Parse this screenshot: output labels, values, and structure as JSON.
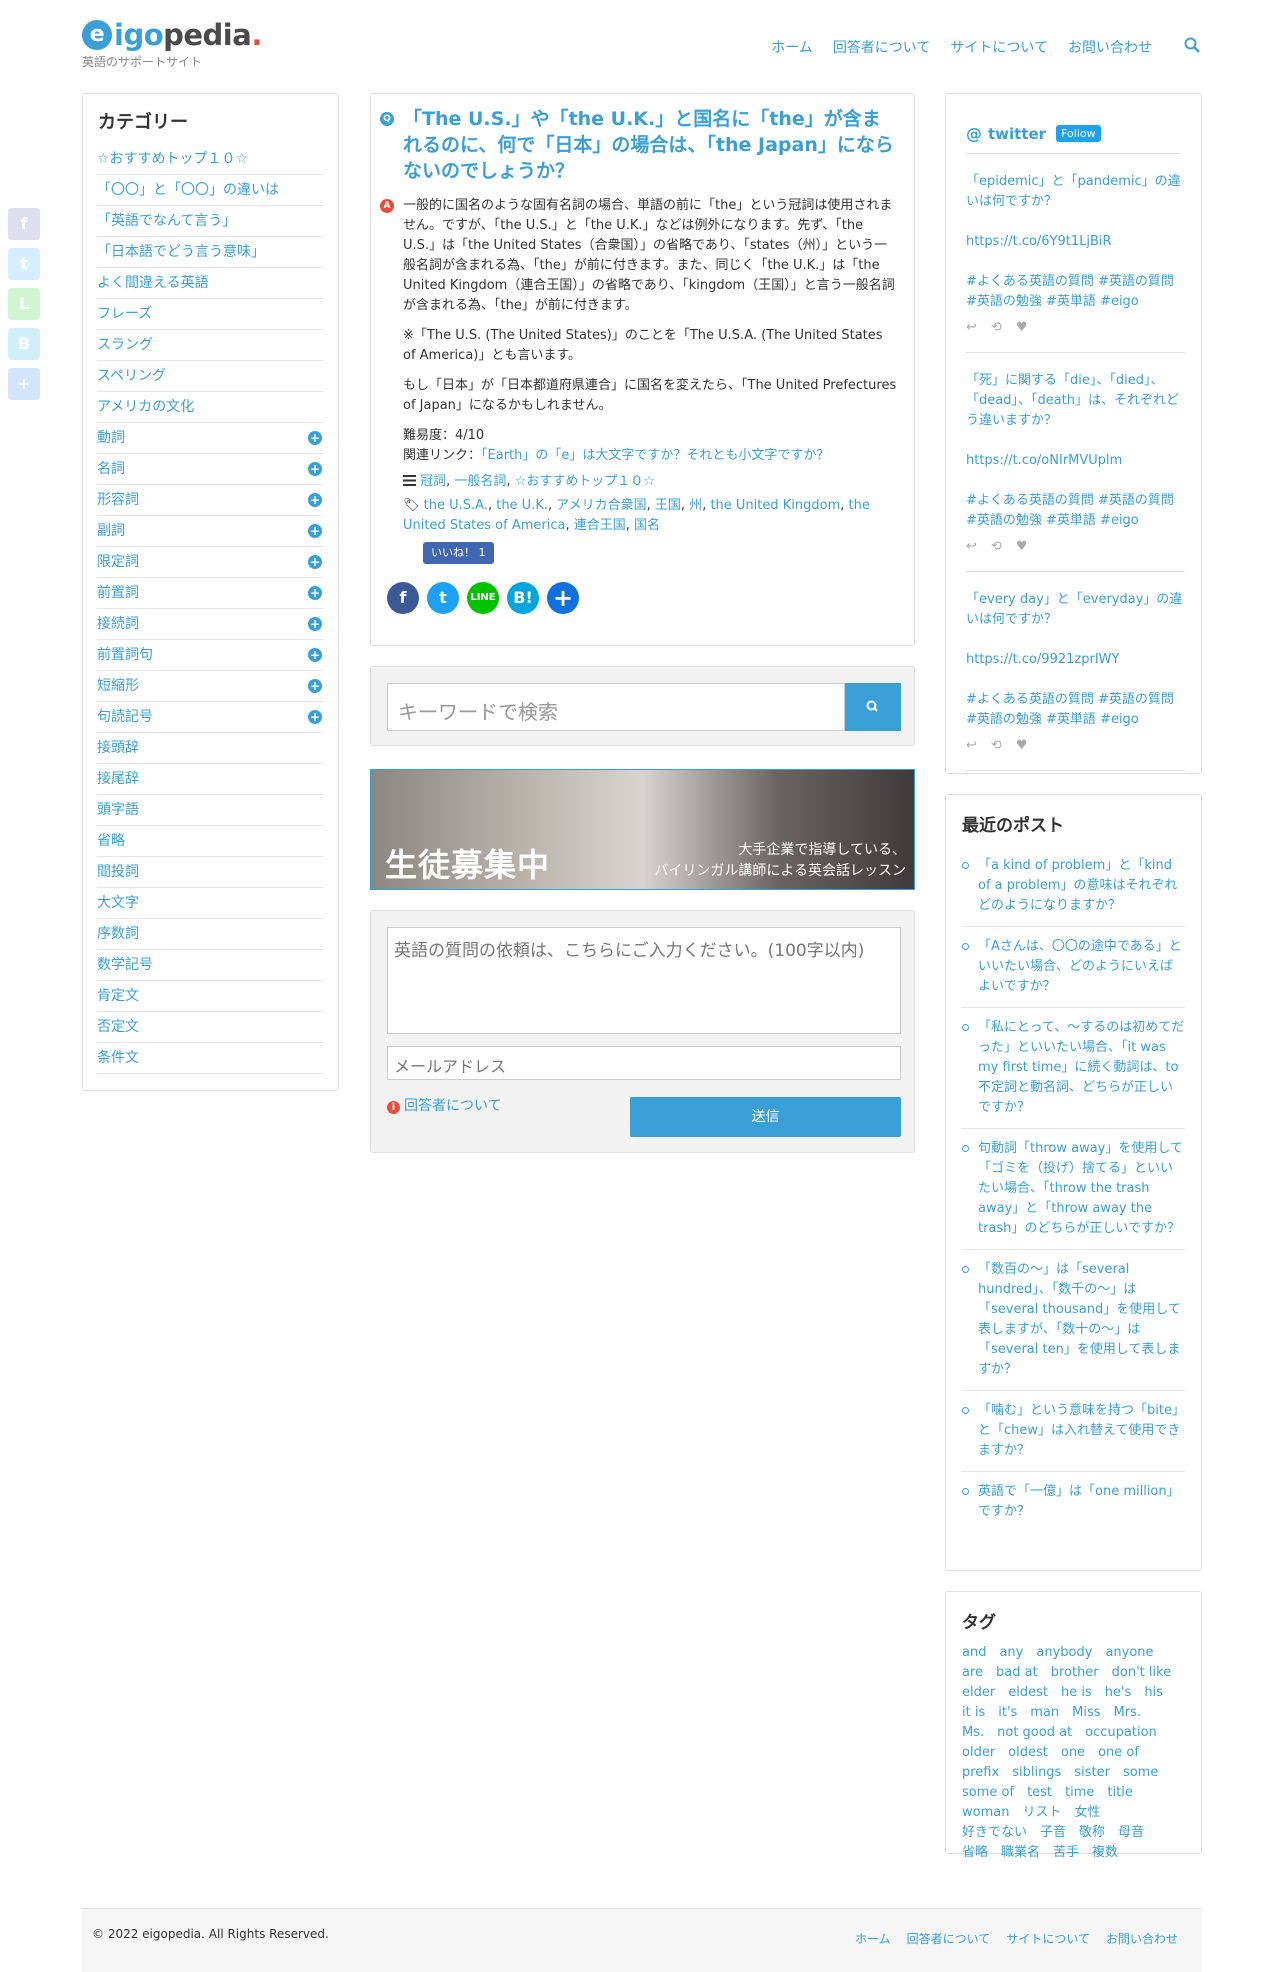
{
  "brand": {
    "logo_e": "e",
    "logo_igo": "igo",
    "logo_pedia": "pedia",
    "logo_dot": ".",
    "tagline": "英語のサポートサイト"
  },
  "nav": {
    "home": "ホーム",
    "respondents": "回答者について",
    "about": "サイトについて",
    "contact": "お問い合わせ"
  },
  "categories": {
    "title": "カテゴリー",
    "items": [
      {
        "label": "☆おすすめトップ１０☆",
        "expand": false
      },
      {
        "label": "「〇〇」と「〇〇」の違いは",
        "expand": false
      },
      {
        "label": "「英語でなんて言う」",
        "expand": false
      },
      {
        "label": "「日本語でどう言う意味」",
        "expand": false
      },
      {
        "label": "よく間違える英語",
        "expand": false
      },
      {
        "label": "フレーズ",
        "expand": false
      },
      {
        "label": "スラング",
        "expand": false
      },
      {
        "label": "スペリング",
        "expand": false
      },
      {
        "label": "アメリカの文化",
        "expand": false
      },
      {
        "label": "動詞",
        "expand": true
      },
      {
        "label": "名詞",
        "expand": true
      },
      {
        "label": "形容詞",
        "expand": true
      },
      {
        "label": "副詞",
        "expand": true
      },
      {
        "label": "限定詞",
        "expand": true
      },
      {
        "label": "前置詞",
        "expand": true
      },
      {
        "label": "接続詞",
        "expand": true
      },
      {
        "label": "前置詞句",
        "expand": true
      },
      {
        "label": "短縮形",
        "expand": true
      },
      {
        "label": "句読記号",
        "expand": true
      },
      {
        "label": "接頭辞",
        "expand": false
      },
      {
        "label": "接尾辞",
        "expand": false
      },
      {
        "label": "頭字語",
        "expand": false
      },
      {
        "label": "省略",
        "expand": false
      },
      {
        "label": "間投詞",
        "expand": false
      },
      {
        "label": "大文字",
        "expand": false
      },
      {
        "label": "序数詞",
        "expand": false
      },
      {
        "label": "数学記号",
        "expand": false
      },
      {
        "label": "肯定文",
        "expand": false
      },
      {
        "label": "否定文",
        "expand": false
      },
      {
        "label": "条件文",
        "expand": false
      }
    ]
  },
  "question": {
    "q_badge": "Q",
    "a_badge": "A",
    "title": "「The U.S.」や「the U.K.」と国名に「the」が含まれるのに、何で「日本」の場合は、「the Japan」にならないのでしょうか？",
    "answer_p1": "一般的に国名のような固有名詞の場合、単語の前に「the」という冠詞は使用されません。ですが、「the U.S.」と「the U.K.」などは例外になります。先ず、「the U.S.」は「the United States（合衆国）」の省略であり、「states（州）」という一般名詞が含まれる為、「the」が前に付きます。また、同じく「the U.K.」は「the United Kingdom（連合王国）」の省略であり、「kingdom（王国）」と言う一般名詞が含まれる為、「the」が前に付きます。",
    "answer_p2": "※「The U.S. (The United States)」のことを「The U.S.A. (The United States of America)」とも言います。",
    "answer_p3": "もし「日本」が「日本都道府県連合」に国名を変えたら、「The United Prefectures of Japan」になるかもしれません。",
    "difficulty": "難易度：4/10",
    "related_label": "関連リンク：",
    "related_link": "「Earth」の「e」は大文字ですか？それとも小文字ですか？",
    "categories": [
      "冠詞",
      "一般名詞",
      "☆おすすめトップ１０☆"
    ],
    "tags": [
      "the U.S.A.",
      "the U.K.",
      "アメリカ合衆国",
      "王国",
      "州",
      "the United Kingdom",
      "the United States of America",
      "連合王国",
      "国名"
    ],
    "like": "いいね！ 1"
  },
  "search": {
    "placeholder": "キーワードで検索"
  },
  "banner": {
    "big": "生徒募集中",
    "line1": "大手企業で指導している、",
    "line2": "バイリンガル講師による英会話レッスン"
  },
  "ask": {
    "question_placeholder": "英語の質問の依頼は、こちらにご入力ください。(100字以内)",
    "email_placeholder": "メールアドレス",
    "respondents_link": "回答者について",
    "send": "送信"
  },
  "twitter": {
    "title": "twitter",
    "follow": "Follow",
    "tweets": [
      {
        "text": "「epidemic」と「pandemic」の違いは何ですか？",
        "url": "https://t.co/6Y9t1LjBiR",
        "tags": "#よくある英語の質問 #英語の質問 #英語の勉強 #英単語 #eigo"
      },
      {
        "text": "「死」に関する「die」、「died」、「dead」、「death」は、それぞれどう違いますか？",
        "url": "https://t.co/oNIrMVUplm",
        "tags": "#よくある英語の質問 #英語の質問 #英語の勉強 #英単語 #eigo"
      },
      {
        "text": "「every day」と「everyday」の違いは何ですか？",
        "url": "https://t.co/9921zprIWY",
        "tags": "#よくある英語の質問 #英語の質問 #英語の勉強 #英単語 #eigo"
      }
    ]
  },
  "recent": {
    "title": "最近のポスト",
    "items": [
      "「a kind of problem」と「kind of a problem」の意味はそれぞれどのようになりますか？",
      "「Aさんは、〇〇の途中である」といいたい場合、どのようにいえばよいですか？",
      "「私にとって、〜するのは初めてだった」といいたい場合、「it was my first time」に続く動詞は、to不定詞と動名詞、どちらが正しいですか？",
      "句動詞「throw away」を使用して「ゴミを（投げ）捨てる」といいたい場合、「throw the trash away」と「throw away the trash」のどちらが正しいですか？",
      "「数百の〜」は「several hundred」、「数千の〜」は「several thousand」を使用して表しますが、「数十の〜」は「several ten」を使用して表しますか？",
      "「噛む」という意味を持つ「bite」と「chew」は入れ替えて使用できますか？",
      "英語で「一億」は「one million」ですか？"
    ]
  },
  "tagcloud": {
    "title": "タグ",
    "items": [
      "and",
      "any",
      "anybody",
      "anyone",
      "are",
      "bad at",
      "brother",
      "don't like",
      "elder",
      "eldest",
      "he is",
      "he's",
      "his",
      "it is",
      "it's",
      "man",
      "Miss",
      "Mrs.",
      "Ms.",
      "not good at",
      "occupation",
      "older",
      "oldest",
      "one",
      "one of",
      "prefix",
      "siblings",
      "sister",
      "some",
      "some of",
      "test",
      "time",
      "title",
      "woman",
      "リスト",
      "女性",
      "好きでない",
      "子音",
      "敬称",
      "母音",
      "省略",
      "職業名",
      "苦手",
      "複数"
    ]
  },
  "footer": {
    "copyright": "© 2022 eigopedia. All Rights Reserved.",
    "home": "ホーム",
    "respondents": "回答者について",
    "about": "サイトについて",
    "contact": "お問い合わせ"
  },
  "colors": {
    "accent": "#3a9fd6",
    "logo_dot": "#e84c3d",
    "facebook": "#3b5998",
    "twitter": "#1da1f2",
    "line": "#00c300",
    "hatena": "#00a4de",
    "plus": "#0f70e0"
  }
}
